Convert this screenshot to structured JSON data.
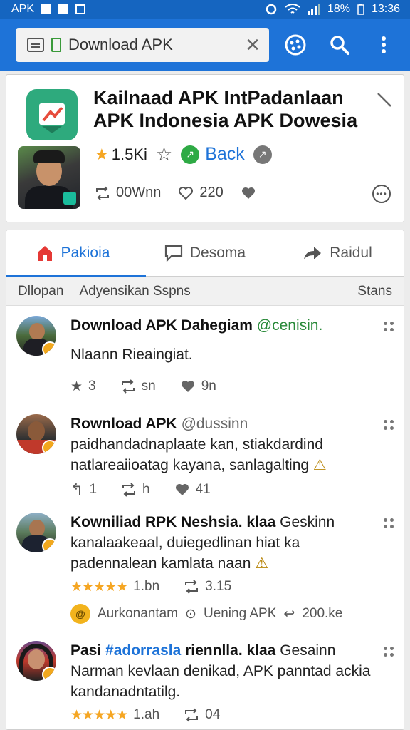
{
  "status_bar": {
    "app": "APK",
    "battery": "18%",
    "time": "13:36"
  },
  "toolbar": {
    "url_text": "Download APK",
    "close_glyph": "✕"
  },
  "app_card": {
    "title": "Kailnaad APK IntPadanlaan APK Indonesia APK Dowesia",
    "rating": "1.5Ki",
    "back_label": "Back",
    "reposts": "00Wnn",
    "likes": "220"
  },
  "tabs": [
    {
      "label": "Pakioia",
      "active": true
    },
    {
      "label": "Desoma",
      "active": false
    },
    {
      "label": "Raidul",
      "active": false
    }
  ],
  "filter": {
    "left": "Dllopan",
    "middle": "Adyensikan Sspns",
    "right": "Stans"
  },
  "posts": [
    {
      "name": "Download APK Dahegiam",
      "handle": "@cenisin.",
      "text": "Nlaann Rieaingiat.",
      "a1": "3",
      "a2": "sn",
      "a3": "9n"
    },
    {
      "name": "Rownload APK",
      "handle": "@dussinn",
      "text": "paidhandadnaplaate kan, stiakdardind natlareaiioatag kayana, sanlagalting",
      "a1": "1",
      "a2": "h",
      "a3": "41"
    },
    {
      "name": "Kowniliad RPK Neshsia. klaa",
      "handle": "Geskinn",
      "text": "kanalaakeaal, duiegedlinan hiat ka padennalean kamlata naan",
      "rating": "1.bn",
      "reposts": "3.15",
      "sponsored": {
        "name": "Aurkonantam",
        "meta": "Uening APK",
        "count": "200.ke"
      }
    },
    {
      "name_prefix": "Pasi",
      "hashtag": "#adorrasla",
      "name_suffix": "riennlla. klaa",
      "handle": "Gesainn",
      "text": "Narman kevlaan denikad, APK panntad ackia kandanadntatilg.",
      "rating": "1.ah",
      "reposts": "04"
    }
  ],
  "colors": {
    "accent": "#1e73d8",
    "status_bar": "#1565c0",
    "star": "#f5a623",
    "green": "#2eaa45"
  }
}
